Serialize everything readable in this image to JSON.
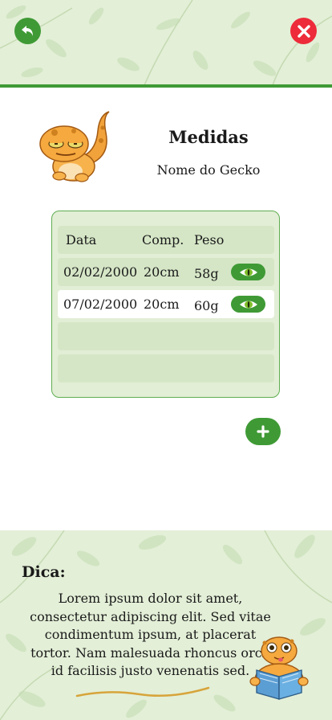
{
  "header": {
    "back_icon": "back-arrow-icon",
    "close_icon": "close-icon",
    "close_label": "X"
  },
  "colors": {
    "primary_green": "#3f9a35",
    "danger_red": "#ed2b3a",
    "leaf_bg": "#e3efd7"
  },
  "page": {
    "title": "Medidas",
    "subtitle": "Nome do Gecko"
  },
  "table": {
    "headers": {
      "date": "Data",
      "comp": "Comp.",
      "peso": "Peso"
    },
    "rows": [
      {
        "date": "02/02/2000",
        "comp": "20cm",
        "peso": "58g",
        "action_icon": "eye-icon"
      },
      {
        "date": "07/02/2000",
        "comp": "20cm",
        "peso": "60g",
        "action_icon": "eye-icon"
      }
    ]
  },
  "add_button": {
    "label": "+"
  },
  "tip": {
    "title": "Dica:",
    "lines": [
      "Lorem ipsum dolor sit amet,",
      "consectetur adipiscing elit. Sed vitae",
      "condimentum ipsum, at placerat",
      "tortor. Nam malesuada rhoncus orci,",
      "id facilisis justo venenatis sed."
    ]
  }
}
